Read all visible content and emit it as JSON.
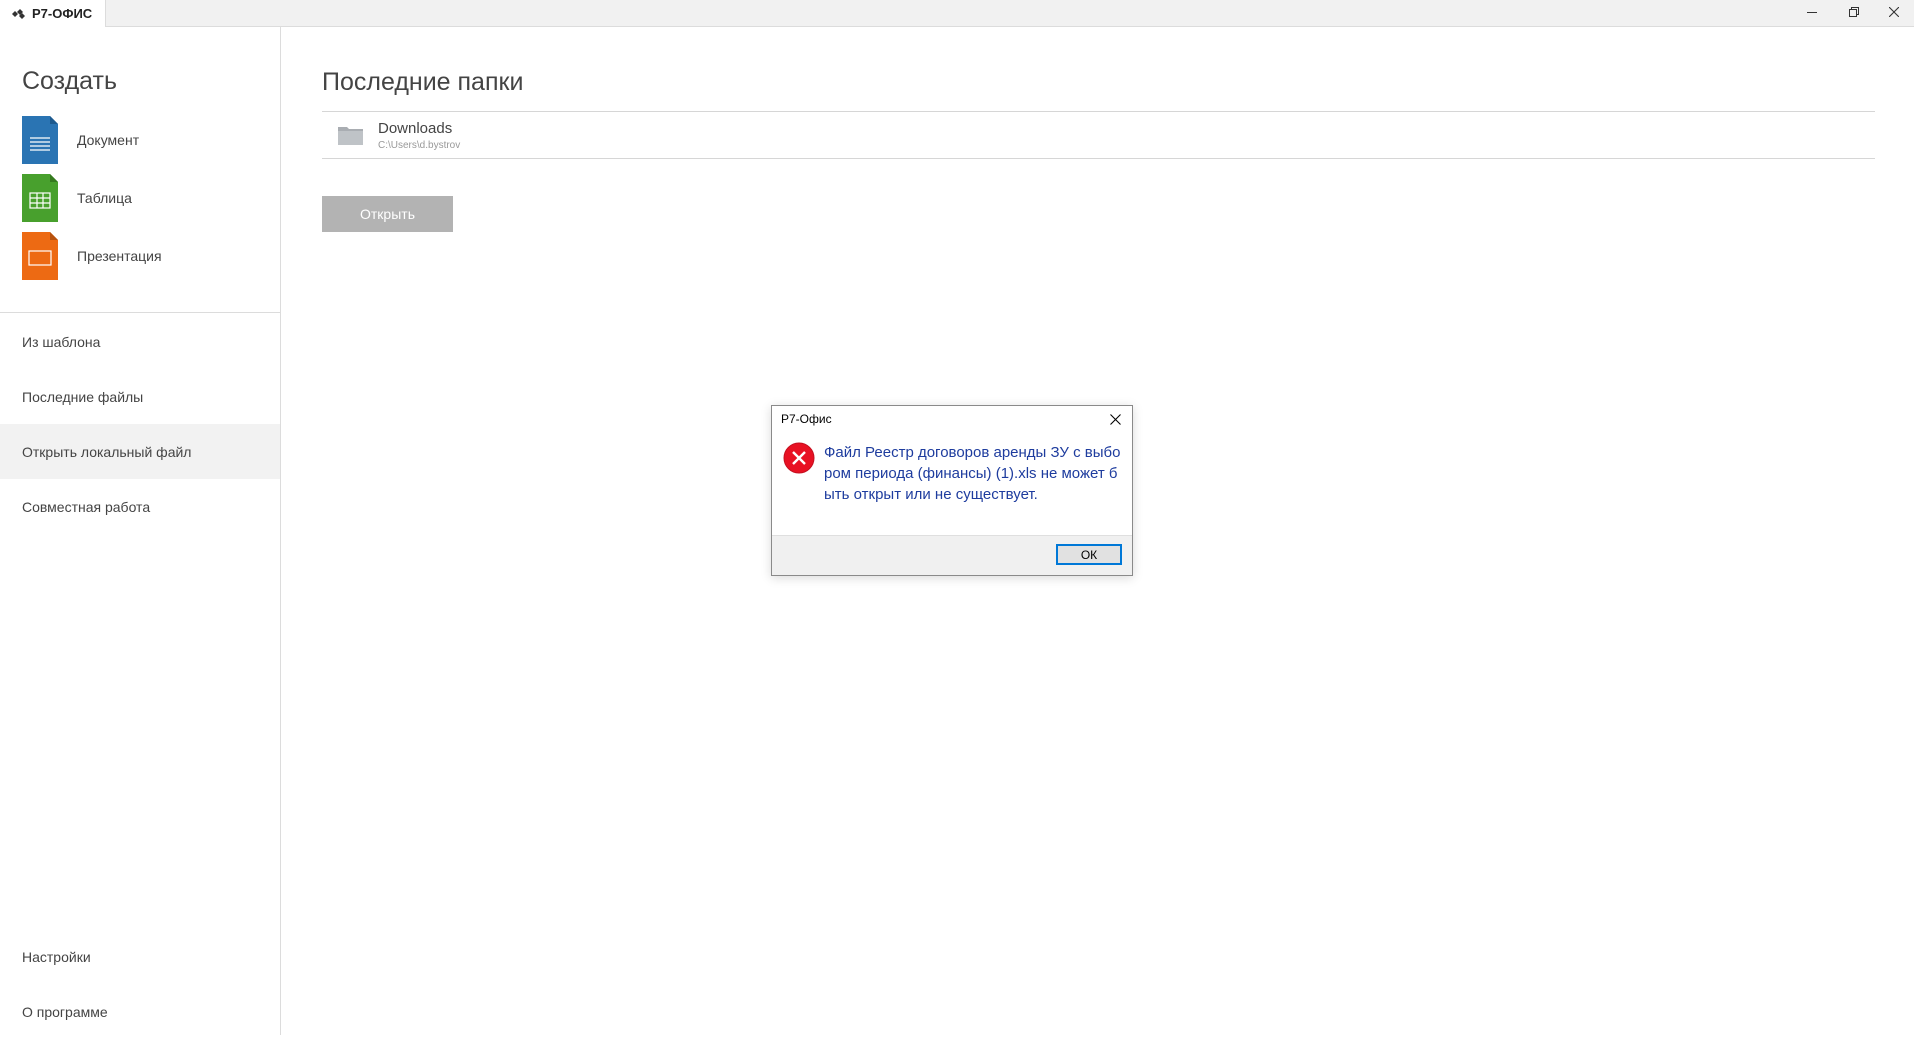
{
  "window": {
    "app_title": "Р7-ОФИС",
    "minimize_icon": "minimize-icon",
    "restore_icon": "restore-icon",
    "close_icon": "close-icon"
  },
  "sidebar": {
    "create_heading": "Создать",
    "create_items": [
      {
        "label": "Документ",
        "icon": "document-icon",
        "color": "#2a74b3"
      },
      {
        "label": "Таблица",
        "icon": "spreadsheet-icon",
        "color": "#48a02d"
      },
      {
        "label": "Презентация",
        "icon": "presentation-icon",
        "color": "#ed6a13"
      }
    ],
    "nav_items": [
      {
        "label": "Из шаблона"
      },
      {
        "label": "Последние файлы"
      },
      {
        "label": "Открыть локальный файл",
        "active": true
      },
      {
        "label": "Совместная работа"
      }
    ],
    "bottom_items": [
      {
        "label": "Настройки"
      },
      {
        "label": "О программе"
      }
    ]
  },
  "main": {
    "title": "Последние папки",
    "folders": [
      {
        "name": "Downloads",
        "path": "C:\\Users\\d.bystrov",
        "icon": "folder-icon"
      }
    ],
    "open_button": "Открыть"
  },
  "dialog": {
    "title": "Р7-Офис",
    "icon": "error-icon",
    "message": "Файл Реестр договоров аренды ЗУ с выбором периода (финансы) (1).xls не может быть открыт или не существует.",
    "ok_label": "ОК"
  }
}
